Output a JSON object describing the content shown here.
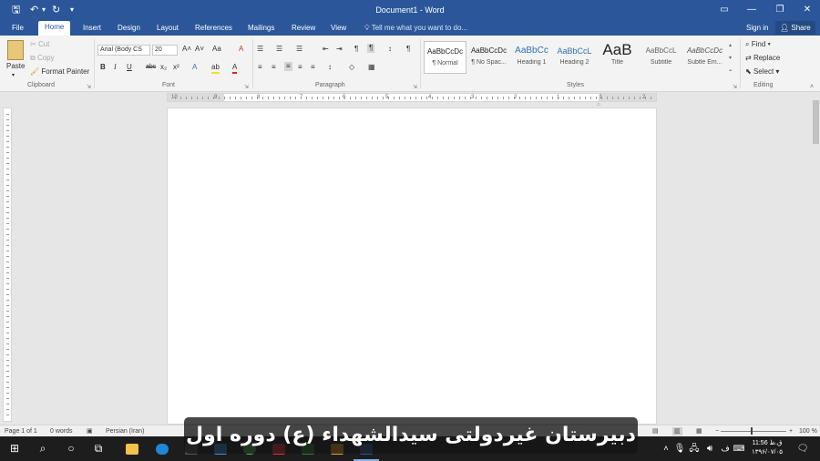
{
  "window": {
    "title": "Document1 - Word",
    "quick_access": {
      "save": "🖫",
      "undo": "↶",
      "undo_dropdown": "▾",
      "redo": "↻",
      "customize": "▾"
    },
    "controls": {
      "ribbon_options": "▭",
      "minimize": "—",
      "restore": "❐",
      "close": "✕"
    }
  },
  "tabs": [
    "File",
    "Home",
    "Insert",
    "Design",
    "Layout",
    "References",
    "Mailings",
    "Review",
    "View"
  ],
  "active_tab": "Home",
  "tell_me": "Tell me what you want to do...",
  "account": {
    "sign_in": "Sign in",
    "share": "Share"
  },
  "clipboard": {
    "label": "Clipboard",
    "paste": "Paste",
    "cut": "Cut",
    "copy": "Copy",
    "format_painter": "Format Painter"
  },
  "font": {
    "label": "Font",
    "name": "Arial (Body CS",
    "size": "20",
    "grow": "A˄",
    "shrink": "A˅",
    "change_case": "Aa",
    "clear": "A",
    "bold": "B",
    "italic": "I",
    "underline": "U",
    "strike": "abc",
    "subscript": "x₂",
    "superscript": "x²",
    "effects": "A",
    "highlight": "ab",
    "color": "A"
  },
  "paragraph": {
    "label": "Paragraph",
    "bullets": "☰",
    "numbering": "☰",
    "multilevel": "☰",
    "decrease_indent": "⇤",
    "increase_indent": "⇥",
    "ltr": "¶",
    "rtl": "¶",
    "sort": "↕",
    "show_marks": "¶",
    "align_left": "≡",
    "center": "≡",
    "align_right": "≡",
    "justify": "≡",
    "distributed": "≡",
    "line_spacing": "↕",
    "shading": "◇",
    "borders": "▦"
  },
  "styles": {
    "label": "Styles",
    "items": [
      {
        "sample": "AaBbCcDc",
        "name": "¶ Normal"
      },
      {
        "sample": "AaBbCcDc",
        "name": "¶ No Spac..."
      },
      {
        "sample": "AaBbCc",
        "name": "Heading 1"
      },
      {
        "sample": "AaBbCcL",
        "name": "Heading 2"
      },
      {
        "sample": "AaB",
        "name": "Title"
      },
      {
        "sample": "AaBbCcL",
        "name": "Subtitle"
      },
      {
        "sample": "AaBbCcDc",
        "name": "Subtle Em..."
      }
    ]
  },
  "editing": {
    "label": "Editing",
    "find": "Find",
    "replace": "Replace",
    "select": "Select"
  },
  "ruler_numbers": [
    "10",
    "9",
    "8",
    "7",
    "6",
    "5",
    "4",
    "3",
    "2",
    "1",
    "1",
    "2"
  ],
  "status": {
    "page": "Page 1 of 1",
    "words": "0 words",
    "language": "Persian (Iran)",
    "zoom": "100 %"
  },
  "clock": {
    "time": "ق.ظ 11:56",
    "date": "۱۳۹۶/۰۷/۰۵"
  },
  "caption": "دبیرستان غیردولتی سیدالشهداء (ع) دوره اول",
  "colors": {
    "accent": "#2b579a",
    "taskbar": "#1d1d1d"
  }
}
